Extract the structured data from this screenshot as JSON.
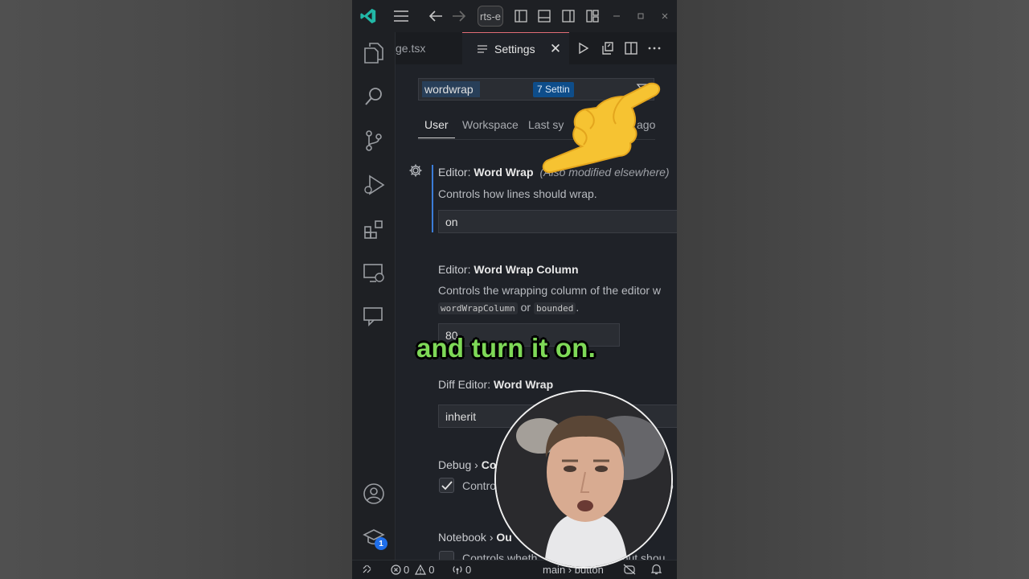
{
  "titlebar": {
    "search_text": "rts-e",
    "icons": [
      "vscode-logo-icon",
      "menu-icon",
      "back-arrow-icon",
      "forward-arrow-icon",
      "toggle-primary-sidebar-icon",
      "toggle-panel-icon",
      "toggle-secondary-sidebar-icon",
      "customize-layout-icon",
      "minimize-icon",
      "maximize-icon",
      "close-icon"
    ]
  },
  "activitybar": {
    "items": [
      "explorer-icon",
      "search-icon",
      "source-control-icon",
      "run-debug-icon",
      "extensions-icon",
      "remote-explorer-icon",
      "chat-icon"
    ],
    "bottom": [
      "accounts-icon",
      "manage-education-icon"
    ],
    "badge": "1"
  },
  "tabs": {
    "inactive": "ge.tsx",
    "active": "Settings",
    "close": "✕"
  },
  "settings": {
    "search_value": "wordwrap",
    "result_count": "7 Settin",
    "scopes": {
      "user": "User",
      "workspace": "Workspace",
      "last_synced": "Last sy",
      "ago": "ago"
    },
    "items": [
      {
        "title_prefix": "Editor: ",
        "title": "Word Wrap",
        "note": "(Also modified elsewhere)",
        "description": "Controls how lines should wrap.",
        "value": "on"
      },
      {
        "title_prefix": "Editor: ",
        "title": "Word Wrap Column",
        "description": "Controls the wrapping column of the editor w",
        "chip1": "wordWrapColumn",
        "or": "or",
        "chip2": "bounded",
        "period": ".",
        "value": "80"
      },
      {
        "title_prefix": "Diff Editor: ",
        "title": "Word Wrap",
        "value": "inherit"
      },
      {
        "title_prefix": "Debug › ",
        "title": "Co",
        "checkbox_label": "Contro",
        "checkbox_label_tail": "o",
        "checked": true
      },
      {
        "title_prefix": "Notebook › ",
        "title": "Ou",
        "checkbox_label": "Controls wheth",
        "checkbox_label_tail": "utput shou",
        "checked": false
      }
    ]
  },
  "statusbar": {
    "errors": "0",
    "warnings": "0",
    "ports": "0",
    "branch": "main › button"
  },
  "caption": "and turn it on.",
  "colors": {
    "accent": "#3b7dd8",
    "caption": "#7ed957",
    "badge": "#0e4d8a"
  }
}
